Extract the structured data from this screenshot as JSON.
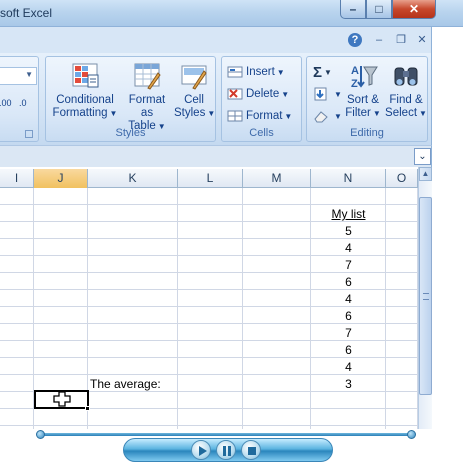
{
  "window": {
    "title": "soft Excel",
    "minimize": "–",
    "maximize": "□",
    "close": "✕"
  },
  "ribbon_tools": {
    "help": "?",
    "min": "–",
    "restore": "❐",
    "close": "✕"
  },
  "groups": {
    "styles": {
      "label": "Styles",
      "conditional_formatting": [
        "Conditional",
        "Formatting"
      ],
      "format_as_table": [
        "Format",
        "as Table"
      ],
      "cell_styles": [
        "Cell",
        "Styles"
      ]
    },
    "cells": {
      "label": "Cells",
      "insert": "Insert",
      "delete": "Delete",
      "format": "Format"
    },
    "editing": {
      "label": "Editing",
      "sum_symbol": "Σ",
      "sort_filter": [
        "Sort &",
        "Filter"
      ],
      "find_select": [
        "Find &",
        "Select"
      ]
    }
  },
  "number_format": {
    "inc_decimal": ".00",
    "dec_decimal": ".0"
  },
  "columns": [
    "I",
    "J",
    "K",
    "L",
    "M",
    "N",
    "O"
  ],
  "selected_column": "J",
  "cells": {
    "list_header": "My list",
    "list_values": [
      "5",
      "4",
      "7",
      "6",
      "4",
      "6",
      "7",
      "6",
      "4",
      "3"
    ],
    "average_label": "The average:"
  },
  "player": {
    "prev_icon": "play-icon",
    "pause_icon": "pause-icon",
    "stop_icon": "stop-icon"
  },
  "colors": {
    "ribbon_text": "#15428b",
    "selected_col": "#f1c15f",
    "grid_line": "#d0d7e5"
  }
}
